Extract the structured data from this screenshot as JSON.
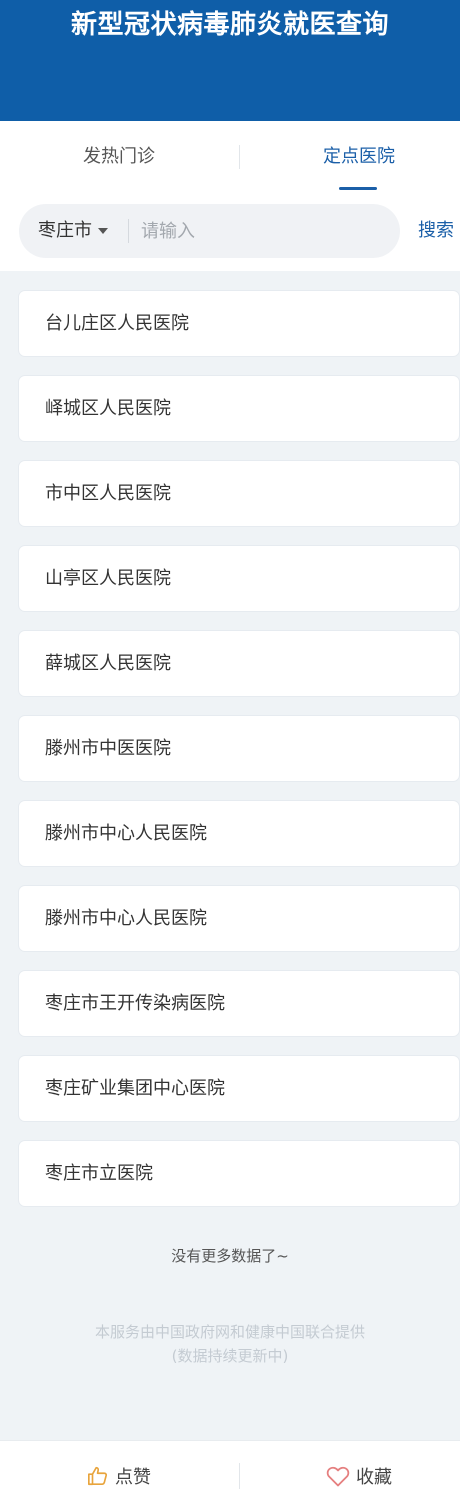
{
  "header": {
    "title": "新型冠状病毒肺炎就医查询"
  },
  "tabs": [
    {
      "label": "发热门诊",
      "active": false
    },
    {
      "label": "定点医院",
      "active": true
    }
  ],
  "search": {
    "city": "枣庄市",
    "placeholder": "请输入",
    "value": "",
    "button_label": "搜索"
  },
  "hospitals": [
    "台儿庄区人民医院",
    "峄城区人民医院",
    "市中区人民医院",
    "山亭区人民医院",
    "薛城区人民医院",
    "滕州市中医医院",
    "滕州市中心人民医院",
    "滕州市中心人民医院",
    "枣庄市王开传染病医院",
    "枣庄矿业集团中心医院",
    "枣庄市立医院"
  ],
  "list_end_text": "没有更多数据了~",
  "footer": {
    "line1": "本服务由中国政府网和健康中国联合提供",
    "line2": "(数据持续更新中)"
  },
  "bottom_bar": {
    "like_label": "点赞",
    "favorite_label": "收藏"
  },
  "colors": {
    "header_bg": "#0f5ea8",
    "accent": "#1b5fa8",
    "page_bg": "#eff3f6",
    "like_icon": "#e8a43c",
    "favorite_icon": "#e57f7f"
  },
  "icons": {
    "city_dropdown": "caret-down-icon",
    "like": "thumbs-up-icon",
    "favorite": "heart-icon"
  }
}
